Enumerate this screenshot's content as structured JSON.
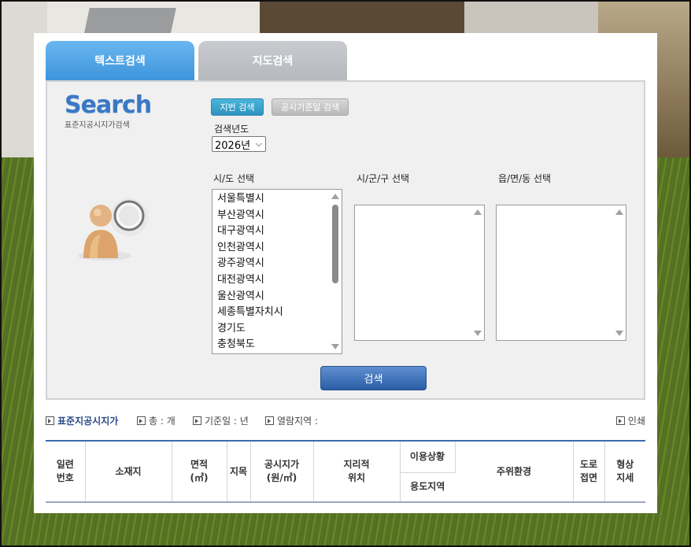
{
  "tabs": {
    "text_search": "텍스트검색",
    "map_search": "지도검색"
  },
  "logo": {
    "title": "Search",
    "subtitle": "표준지공시지가검색"
  },
  "buttons": {
    "jibun": "지번 검색",
    "gongsi_date": "공시기준일 검색",
    "search": "검색"
  },
  "year": {
    "label": "검색년도",
    "selected": "2026년"
  },
  "columns": {
    "sido": "시/도 선택",
    "sigungu": "시/군/구 선택",
    "eupmyeondong": "읍/면/동 선택"
  },
  "sido_list": [
    "서울특별시",
    "부산광역시",
    "대구광역시",
    "인천광역시",
    "광주광역시",
    "대전광역시",
    "울산광역시",
    "세종특별자치시",
    "경기도",
    "충청북도"
  ],
  "info": {
    "title": "표준지공시지가",
    "total": "총 : 개",
    "base_date": "기준일 : 년",
    "area": "열람지역 :",
    "print": "인쇄"
  },
  "table_headers": {
    "serial": "일련\n번호",
    "location": "소재지",
    "area": "면적\n(㎡)",
    "land_category": "지목",
    "price": "공시지가\n(원/㎡)",
    "geo_position": "지리적\n위치",
    "usage_status": "이용상황",
    "zoning": "용도지역",
    "surroundings": "주위환경",
    "road_frontage": "도로\n접면",
    "shape_terrain": "형상\n지세"
  }
}
